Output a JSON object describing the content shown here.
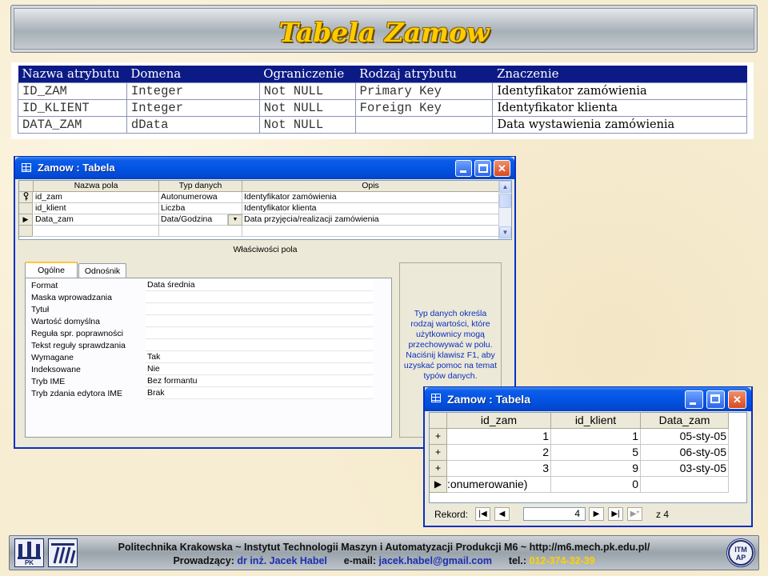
{
  "slide": {
    "title": "Tabela Zamow"
  },
  "attr_table": {
    "headers": [
      "Nazwa atrybutu",
      "Domena",
      "Ograniczenie",
      "Rodzaj atrybutu",
      "Znaczenie"
    ],
    "rows": [
      [
        "ID_ZAM",
        "Integer",
        "Not NULL",
        "Primary Key",
        "Identyfikator zamówienia"
      ],
      [
        "ID_KLIENT",
        "Integer",
        "Not NULL",
        "Foreign Key",
        "Identyfikator klienta"
      ],
      [
        "DATA_ZAM",
        "dData",
        "Not NULL",
        "",
        "Data wystawienia zamówienia"
      ]
    ],
    "header_color": "#0c1a86"
  },
  "design_window": {
    "title": "Zamow : Tabela",
    "columns": [
      "Nazwa pola",
      "Typ danych",
      "Opis"
    ],
    "rows": [
      {
        "selector": "key-icon",
        "name": "id_zam",
        "type": "Autonumerowa",
        "desc": "Identyfikator zamówienia"
      },
      {
        "selector": "",
        "name": "id_klient",
        "type": "Liczba",
        "desc": "Identyfikator klienta"
      },
      {
        "selector": "current-row-arrow-icon",
        "name": "Data_zam",
        "type": "Data/Godzina",
        "desc": "Data przyjęcia/realizacji zamówienia"
      }
    ],
    "props_label": "Właściwości pola",
    "tabs": [
      "Ogólne",
      "Odnośnik"
    ],
    "properties": [
      {
        "name": "Format",
        "value": "Data średnia"
      },
      {
        "name": "Maska wprowadzania",
        "value": ""
      },
      {
        "name": "Tytuł",
        "value": ""
      },
      {
        "name": "Wartość domyślna",
        "value": ""
      },
      {
        "name": "Reguła spr. poprawności",
        "value": ""
      },
      {
        "name": "Tekst reguły sprawdzania",
        "value": ""
      },
      {
        "name": "Wymagane",
        "value": "Tak"
      },
      {
        "name": "Indeksowane",
        "value": "Nie"
      },
      {
        "name": "Tryb IME",
        "value": "Bez formantu"
      },
      {
        "name": "Tryb zdania edytora IME",
        "value": "Brak"
      }
    ],
    "help_text": "Typ danych określa rodzaj wartości, które użytkownicy mogą przechowywać w polu. Naciśnij klawisz F1, aby uzyskać pomoc na temat typów danych."
  },
  "datasheet_window": {
    "title": "Zamow : Tabela",
    "columns": [
      "id_zam",
      "id_klient",
      "Data_zam"
    ],
    "rows": [
      {
        "selector": "+",
        "id_zam": "1",
        "id_klient": "1",
        "data_zam": "05-sty-05"
      },
      {
        "selector": "+",
        "id_zam": "2",
        "id_klient": "5",
        "data_zam": "06-sty-05"
      },
      {
        "selector": "+",
        "id_zam": "3",
        "id_klient": "9",
        "data_zam": "03-sty-05"
      },
      {
        "selector": "new-row-arrow-icon",
        "id_zam": ":onumerowanie)",
        "id_klient": "0",
        "data_zam": ""
      }
    ],
    "nav": {
      "label": "Rekord:",
      "current": "4",
      "of_label": "z 4"
    }
  },
  "footer": {
    "line1": "Politechnika Krakowska   ~   Instytut Technologii Maszyn i Automatyzacji Produkcji M6   ~   http://m6.mech.pk.edu.pl/",
    "line2_prefix": "Prowadzący:",
    "lecturer": "dr inż. Jacek Habel",
    "email_label": "e-mail:",
    "email": "jacek.habel@gmail.com",
    "tel_label": "tel.:",
    "tel": "012-374-32-39",
    "logos": [
      "pk-logo",
      "itm-logo",
      "itmap-logo"
    ]
  }
}
